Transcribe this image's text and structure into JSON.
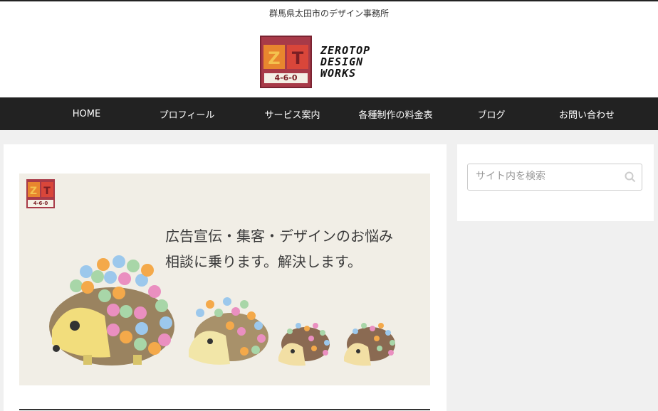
{
  "header": {
    "tagline": "群馬県太田市のデザイン事務所",
    "logo": {
      "mark_letters": "ZT",
      "mark_number": "4-6-0",
      "wordmark": [
        "ZEROTOP",
        "DESIGN",
        "WORKS"
      ]
    }
  },
  "nav": {
    "items": [
      {
        "label": "HOME"
      },
      {
        "label": "プロフィール"
      },
      {
        "label": "サービス案内"
      },
      {
        "label": "各種制作の料金表"
      },
      {
        "label": "ブログ"
      },
      {
        "label": "お問い合わせ"
      }
    ]
  },
  "hero": {
    "line1": "広告宣伝・集客・デザインのお悩み",
    "line2": "相談に乗ります。解決します。",
    "mini_logo_letters": "ZT",
    "mini_logo_number": "4-6-0"
  },
  "sidebar": {
    "search_placeholder": "サイト内を検索"
  },
  "colors": {
    "nav_bg": "#222222",
    "brand": "#a83a48",
    "hero_bg": "#f1eee6"
  }
}
